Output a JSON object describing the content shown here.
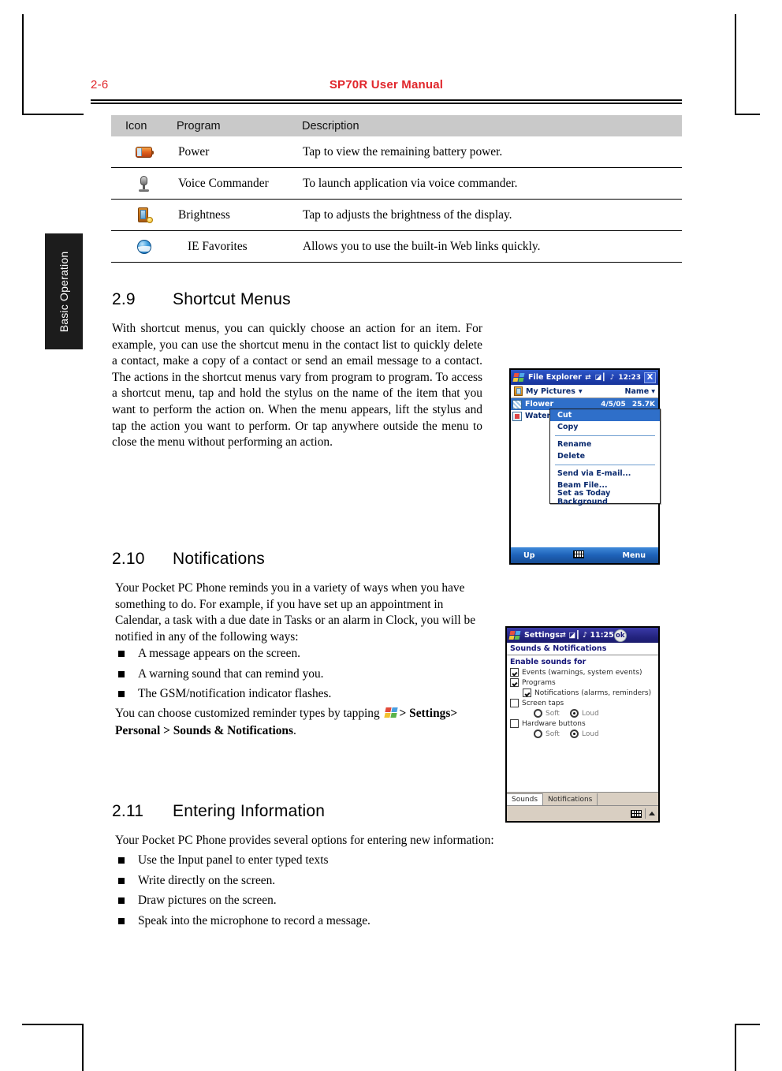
{
  "header": {
    "page_number": "2-6",
    "title": "SP70R User Manual",
    "accent_color": "#e0262b"
  },
  "side_tab": {
    "label": "Basic Operation"
  },
  "icon_table": {
    "columns": [
      "Icon",
      "Program",
      "Description"
    ],
    "rows": [
      {
        "icon": "battery-power-icon",
        "program": "Power",
        "description": "Tap to view the remaining battery power."
      },
      {
        "icon": "microphone-icon",
        "program": "Voice Commander",
        "description": "To launch application via voice commander."
      },
      {
        "icon": "brightness-icon",
        "program": "Brightness",
        "description": "Tap to adjusts the brightness of the display."
      },
      {
        "icon": "globe-favorites-icon",
        "program": "IE Favorites",
        "description": "Allows you to use the built-in Web links quickly."
      }
    ]
  },
  "section_29": {
    "number": "2.9",
    "title": "Shortcut Menus",
    "paragraph": "With shortcut menus, you can quickly choose an action for an item. For example, you can use the shortcut menu in the contact list to quickly delete a contact, make a copy of a contact or send an email message to a contact. The actions in the shortcut menus vary from program to program. To access a shortcut menu, tap and hold the stylus on the name of the item that you want to perform the action on. When the menu appears, lift the stylus and tap the action you want to perform. Or tap anywhere outside the menu to close the menu without performing an action."
  },
  "section_210": {
    "number": "2.10",
    "title": "Notifications",
    "paragraph": "Your Pocket PC Phone reminds you in a variety of ways when you have something to do. For example, if you have set up an appointment in Calendar, a task with a due date in Tasks or an alarm in Clock, you will be notified in any of the following ways:",
    "bullets": [
      "A message appears on the screen.",
      "A warning sound that can remind you.",
      "The GSM/notification indicator flashes."
    ],
    "footer_prefix": "You can choose customized reminder types by tapping",
    "footer_path_1": "> Settings",
    "footer_path_2": "> Personal > Sounds & Notifications",
    "footer_suffix": "."
  },
  "section_211": {
    "number": "2.11",
    "title": "Entering Information",
    "paragraph": "Your Pocket PC Phone provides several options for entering new information:",
    "bullets": [
      "Use the Input panel to enter typed texts",
      "Write directly on the screen.",
      "Draw pictures on the screen.",
      "Speak into the microphone to record a message."
    ]
  },
  "screenshot_file_explorer": {
    "title": "File Explorer",
    "clock": "12:23",
    "close_label": "X",
    "folder_label": "My Pictures",
    "folder_caret": "▾",
    "sort_label": "Name",
    "sort_caret": "▾",
    "files": [
      {
        "name": "Flower",
        "date": "4/5/05",
        "size": "25.7K"
      },
      {
        "name": "Waterfa",
        "date": "",
        "size": ""
      }
    ],
    "context_menu": [
      {
        "label": "Cut",
        "highlighted": true
      },
      {
        "label": "Copy",
        "highlighted": false
      },
      {
        "label": "Rename",
        "highlighted": false
      },
      {
        "label": "Delete",
        "highlighted": false
      },
      {
        "label": "Send via E-mail...",
        "highlighted": false
      },
      {
        "label": "Beam File...",
        "highlighted": false
      },
      {
        "label": "Set as Today Background",
        "highlighted": false
      }
    ],
    "soft_left": "Up",
    "soft_right": "Menu"
  },
  "screenshot_settings": {
    "title": "Settings",
    "clock": "11:25",
    "ok_label": "ok",
    "subtitle": "Sounds & Notifications",
    "group_label": "Enable sounds for",
    "checkboxes": [
      {
        "label": "Events (warnings, system events)",
        "checked": true,
        "indented": false
      },
      {
        "label": "Programs",
        "checked": true,
        "indented": false
      },
      {
        "label": "Notifications (alarms, reminders)",
        "checked": true,
        "indented": true
      },
      {
        "label": "Screen taps",
        "checked": false,
        "indented": false
      }
    ],
    "screen_taps_options": {
      "soft": "Soft",
      "loud": "Loud",
      "selected": "Loud"
    },
    "hardware_buttons": {
      "label": "Hardware buttons",
      "checked": false
    },
    "hardware_options": {
      "soft": "Soft",
      "loud": "Loud",
      "selected": "Loud"
    },
    "tabs": [
      {
        "label": "Sounds",
        "active": true
      },
      {
        "label": "Notifications",
        "active": false
      }
    ]
  }
}
